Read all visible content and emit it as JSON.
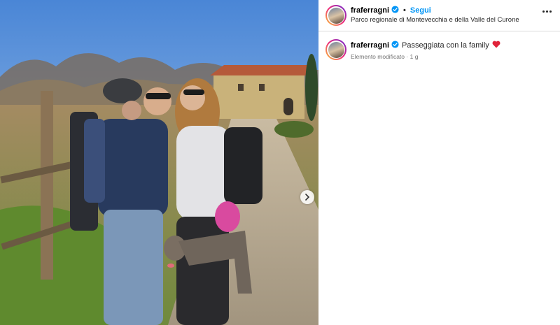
{
  "post": {
    "username": "fraferragni",
    "follow_label": "Segui",
    "separator": "•",
    "location": "Parco regionale di Montevecchia e della Valle del Curone",
    "caption_text": "Passeggiata con la family",
    "meta_status": "Elemento modificato",
    "meta_sep": "·",
    "meta_age": "1 g"
  },
  "colors": {
    "follow": "#0095f6",
    "verified": "#0095f6",
    "heart": "#e0243a",
    "divider": "#dbdbdb"
  },
  "icons": {
    "verified": "verified-badge-icon",
    "more": "more-options-icon",
    "heart": "heart-emoji",
    "next": "chevron-right-icon"
  }
}
